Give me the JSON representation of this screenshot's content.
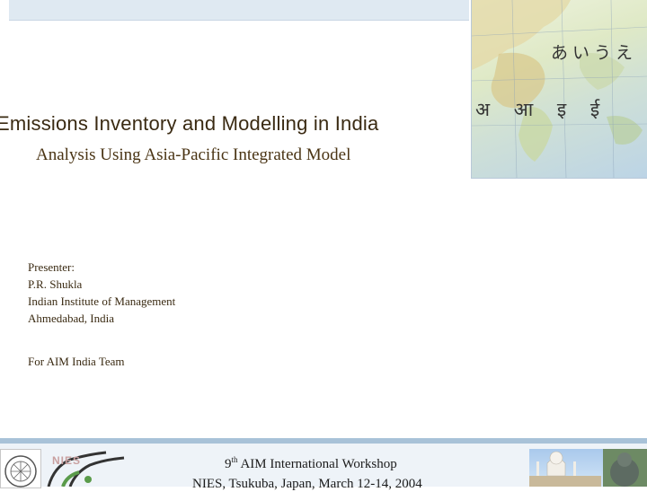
{
  "slide": {
    "title": "Emissions Inventory and Modelling in India",
    "subtitle": "Analysis Using Asia-Pacific Integrated Model",
    "presenter_lines": [
      "Presenter:",
      "P.R. Shukla",
      "Indian Institute of Management",
      "Ahmedabad, India"
    ],
    "team": "For AIM India Team"
  },
  "map_image": {
    "kana": "あいうえ",
    "devanagari": "अ आ इ ई"
  },
  "footer": {
    "workshop_ordinal": "9",
    "workshop_suffix": "th",
    "workshop_name": "AIM International Workshop",
    "venue": "NIES, Tsukuba, Japan, March 12-14, 2004",
    "nies_logo_text": "NIES"
  },
  "colors": {
    "title_text": "#3a2a12",
    "band": "#dfe9f2",
    "footer_rule": "#a8c2d8"
  }
}
